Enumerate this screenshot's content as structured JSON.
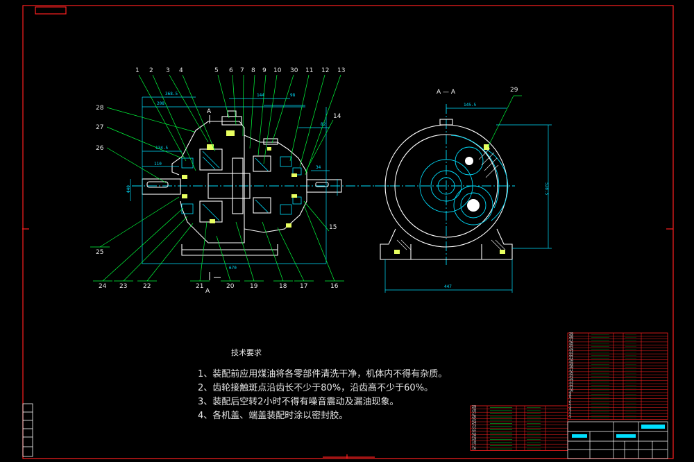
{
  "colors": {
    "background": "#000000",
    "frame": "#ff2020",
    "outline": "#ffffff",
    "section_lines": "#00e0ff",
    "leaders": "#00ff3c",
    "part_fill": "#e8ff60",
    "text": "#e6e6e6"
  },
  "drawing": {
    "main_view": {
      "balloons_top": [
        "1",
        "2",
        "3",
        "4",
        "5",
        "6",
        "7",
        "8",
        "9",
        "10",
        "30",
        "11",
        "12",
        "13"
      ],
      "balloons_right": [
        "14",
        "15"
      ],
      "balloons_bottom": [
        "25",
        "24",
        "23",
        "22",
        "21",
        "20",
        "19",
        "18",
        "17",
        "16"
      ],
      "balloons_left": [
        "28",
        "27",
        "26"
      ],
      "section_marks": [
        "A",
        "A"
      ],
      "dimensions": {
        "d1": "368.5",
        "d2": "208",
        "d3": "144",
        "d4": "98",
        "d5": "134.5",
        "d6": "110",
        "d7": "82",
        "d8": "34",
        "d9": "Φ40",
        "d10": "670"
      }
    },
    "section_view": {
      "title": "A — A",
      "balloon": "29",
      "dimensions": {
        "top": "145.5",
        "right": "528.5",
        "bottom": "447"
      }
    }
  },
  "technical_requirements": {
    "title": "技术要求",
    "lines": [
      "1、装配前应用煤油将各零部件清洗干净，机体内不得有杂质。",
      "2、齿轮接触斑点沿齿长不少于80%，沿齿高不少于60%。",
      "3、装配后空转2小时不得有噪音震动及漏油现象。",
      "4、各机盖、端盖装配时涂以密封胶。"
    ]
  },
  "parts_list_right": {
    "rows": [
      "29",
      "28",
      "27",
      "26",
      "25",
      "24",
      "23",
      "22",
      "21",
      "20",
      "19",
      "18",
      "17",
      "16",
      "15",
      "14",
      "13",
      "12",
      "11",
      "10",
      "9",
      "8",
      "7",
      "6",
      "5",
      "4",
      "3",
      "2",
      "1"
    ]
  },
  "parts_list_left": {
    "rows": [
      "29",
      "28",
      "27",
      "26",
      "25",
      "24",
      "23",
      "22",
      "21",
      "20",
      "19",
      "18",
      "17",
      "16"
    ]
  }
}
